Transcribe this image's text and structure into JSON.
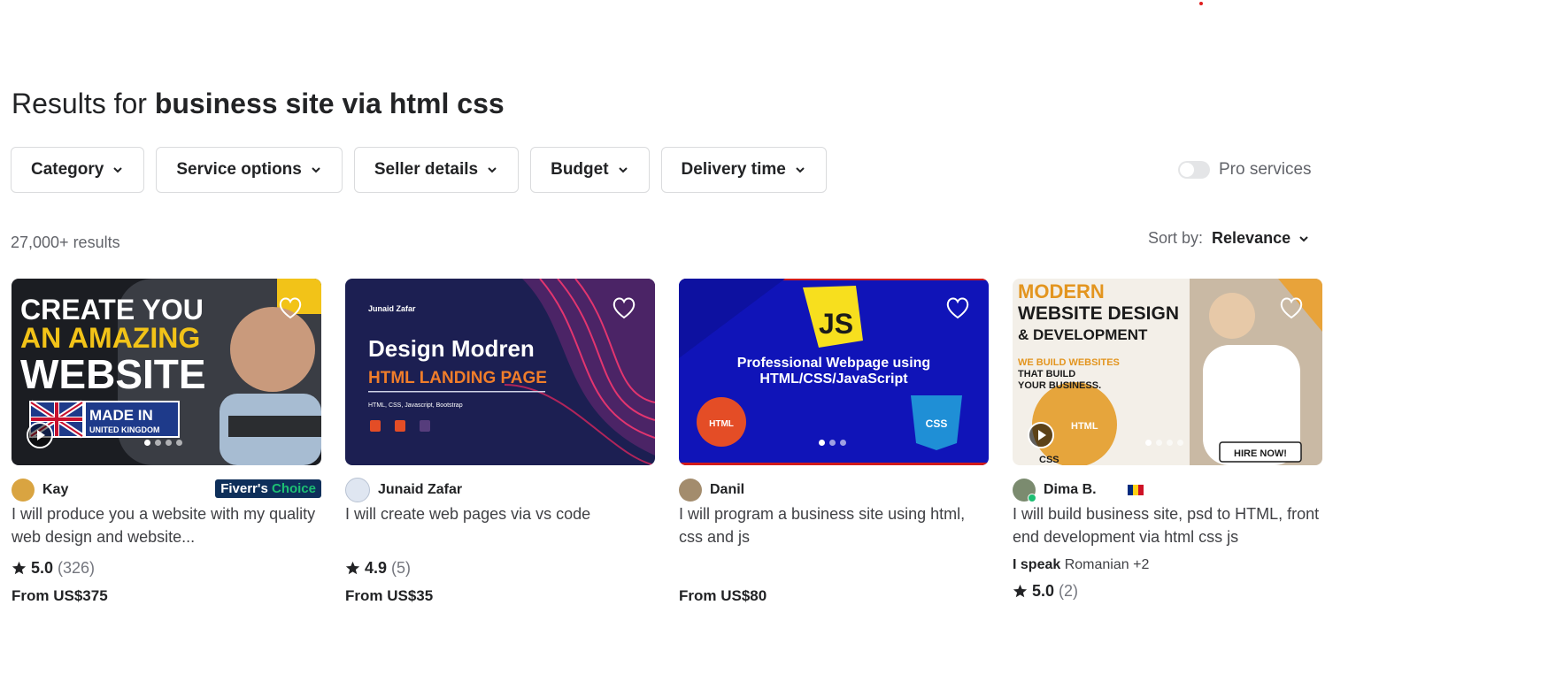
{
  "search": {
    "prefix": "Results for ",
    "query": "business site via html css"
  },
  "filters": [
    "Category",
    "Service options",
    "Seller details",
    "Budget",
    "Delivery time"
  ],
  "pro_services_label": "Pro services",
  "results_count": "27,000+ results",
  "sort": {
    "label": "Sort by:",
    "value": "Relevance"
  },
  "badge": {
    "prefix": "Fiverr's",
    "suffix": "Choice"
  },
  "cards": [
    {
      "seller": "Kay",
      "title": "I will produce you a website with my quality web design and website...",
      "rating": "5.0",
      "reviews": "(326)",
      "price": "From US$375",
      "thumb": {
        "line1": "CREATE YOU",
        "line2": "AN AMAZING",
        "line3": "WEBSITE",
        "made": "MADE IN",
        "uk": "UNITED KINGDOM"
      }
    },
    {
      "seller": "Junaid Zafar",
      "title": "I will create web pages via vs code",
      "rating": "4.9",
      "reviews": "(5)",
      "price": "From US$35",
      "thumb": {
        "brand": "Junaid Zafar",
        "line1": "Design Modren",
        "line2": "HTML LANDING PAGE",
        "tags": "HTML, CSS, Javascript, Bootstrap"
      }
    },
    {
      "seller": "Danil",
      "title": "I will program a business site using html, css and js",
      "price": "From US$80",
      "thumb": {
        "line1": "Professional Webpage using",
        "line2": "HTML/CSS/JavaScript",
        "js": "JS",
        "html": "HTML",
        "css": "CSS"
      }
    },
    {
      "seller": "Dima B.",
      "title": "I will build business site, psd to HTML, front end development via html css js",
      "lang_label": "I speak",
      "lang_value": "Romanian +2",
      "rating": "5.0",
      "reviews": "(2)",
      "thumb": {
        "line1": "MODERN",
        "line2": "WEBSITE DESIGN",
        "line3": "& DEVELOPMENT",
        "sub1": "WE BUILD WEBSITES",
        "sub2": "THAT BUILD",
        "sub3": "YOUR BUSINESS.",
        "html": "HTML",
        "css": "CSS",
        "cta": "HIRE NOW!"
      }
    }
  ],
  "colors": {
    "brand_green": "#1dbf73",
    "text": "#222325",
    "muted": "#62646a"
  }
}
